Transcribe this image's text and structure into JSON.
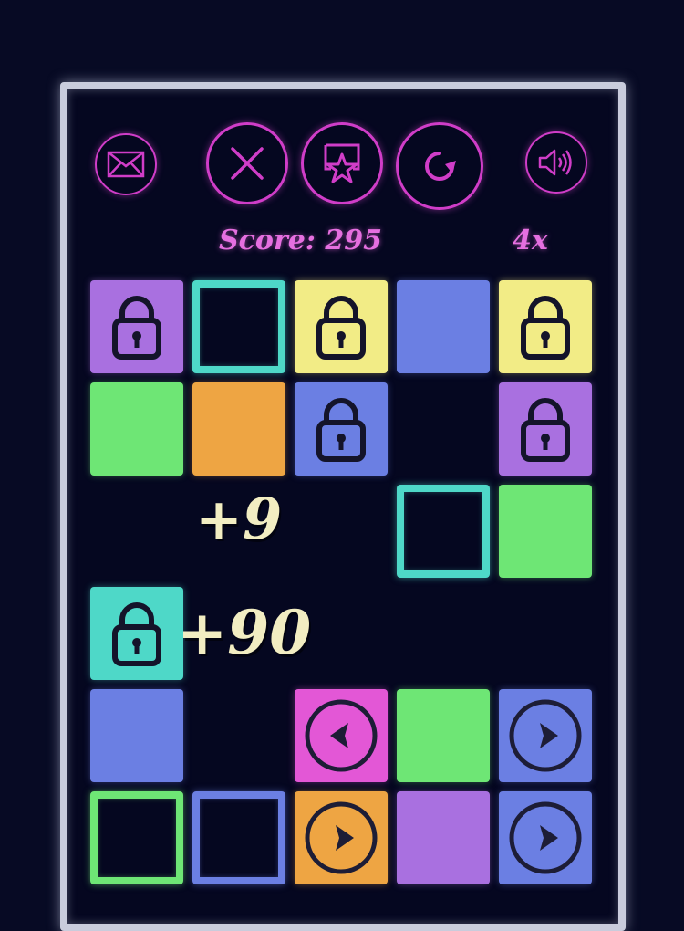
{
  "header": {
    "score_text": "Score: 295",
    "multiplier_text": "4x"
  },
  "toolbar": [
    {
      "name": "mail-icon",
      "label": "mail"
    },
    {
      "name": "close-icon",
      "label": "close"
    },
    {
      "name": "star-share-icon",
      "label": "favorite"
    },
    {
      "name": "restart-icon",
      "label": "restart"
    },
    {
      "name": "speaker-icon",
      "label": "sound"
    }
  ],
  "colors": {
    "purple": "#a970e0",
    "teal": "#4ed8c8",
    "yellow": "#f2ec86",
    "blue": "#6b7fe3",
    "green": "#6ee675",
    "orange": "#eea543",
    "pink": "#e357d6",
    "accent": "#d03dc8"
  },
  "grid": {
    "rows": [
      [
        {
          "color": "purple",
          "style": "filled",
          "icon": "lock"
        },
        {
          "color": "teal",
          "style": "outline",
          "icon": "none"
        },
        {
          "color": "yellow",
          "style": "filled",
          "icon": "lock"
        },
        {
          "color": "blue",
          "style": "filled",
          "icon": "none"
        },
        {
          "color": "yellow",
          "style": "filled",
          "icon": "lock"
        }
      ],
      [
        {
          "color": "green",
          "style": "filled",
          "icon": "none"
        },
        {
          "color": "orange",
          "style": "filled",
          "icon": "none"
        },
        {
          "color": "blue",
          "style": "filled",
          "icon": "lock"
        },
        null,
        {
          "color": "purple",
          "style": "filled",
          "icon": "lock"
        }
      ],
      [
        null,
        null,
        null,
        {
          "color": "teal",
          "style": "outline",
          "icon": "none"
        },
        {
          "color": "green",
          "style": "filled",
          "icon": "none"
        }
      ],
      [
        {
          "color": "teal",
          "style": "filled",
          "icon": "lock"
        },
        null,
        null,
        null,
        null
      ],
      [
        {
          "color": "blue",
          "style": "filled",
          "icon": "none"
        },
        null,
        {
          "color": "pink",
          "style": "filled",
          "icon": "arrow-left"
        },
        {
          "color": "green",
          "style": "filled",
          "icon": "none"
        },
        {
          "color": "blue",
          "style": "filled",
          "icon": "arrow-right"
        }
      ],
      [
        {
          "color": "green",
          "style": "outline",
          "icon": "none"
        },
        {
          "color": "blue",
          "style": "outline",
          "icon": "none"
        },
        {
          "color": "orange",
          "style": "filled",
          "icon": "arrow-right"
        },
        {
          "color": "purple",
          "style": "filled",
          "icon": "none"
        },
        {
          "color": "blue",
          "style": "filled",
          "icon": "arrow-right"
        }
      ]
    ]
  },
  "popups": [
    {
      "text": "+9"
    },
    {
      "text": "+90"
    }
  ]
}
